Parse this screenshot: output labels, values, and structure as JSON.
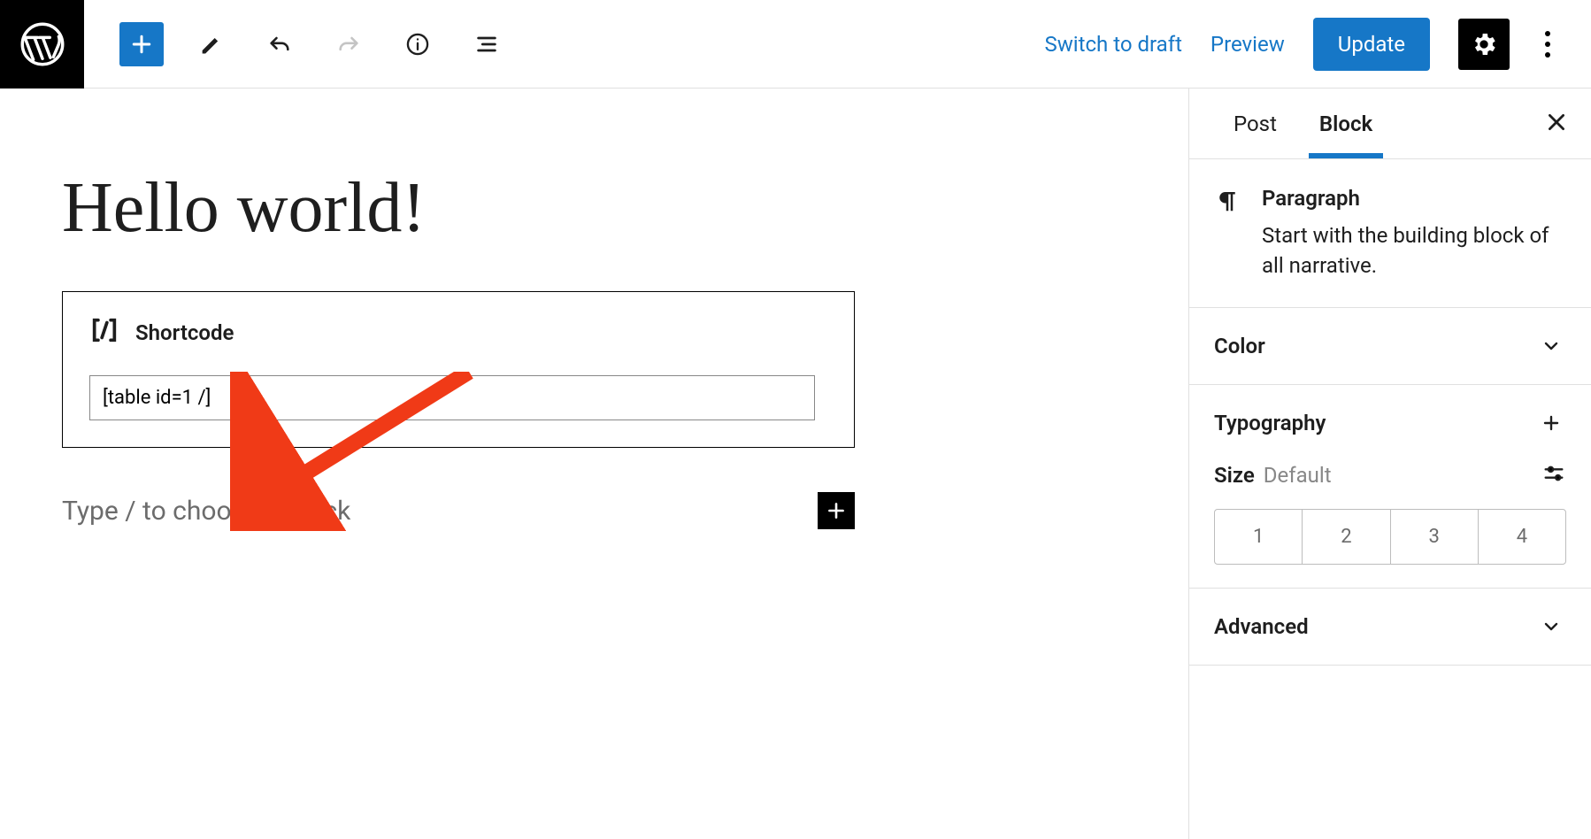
{
  "toolbar": {
    "switch_draft": "Switch to draft",
    "preview": "Preview",
    "update": "Update"
  },
  "editor": {
    "post_title": "Hello world!",
    "shortcode_block": {
      "label": "Shortcode",
      "value": "[table id=1 /]"
    },
    "block_placeholder": "Type / to choose a block"
  },
  "sidebar": {
    "tabs": {
      "post": "Post",
      "block": "Block",
      "active": "Block"
    },
    "block_info": {
      "name": "Paragraph",
      "desc": "Start with the building block of all narrative."
    },
    "panels": {
      "color": "Color",
      "typography": "Typography",
      "size_label": "Size",
      "size_default": "Default",
      "size_options": [
        "1",
        "2",
        "3",
        "4"
      ],
      "advanced": "Advanced"
    }
  }
}
